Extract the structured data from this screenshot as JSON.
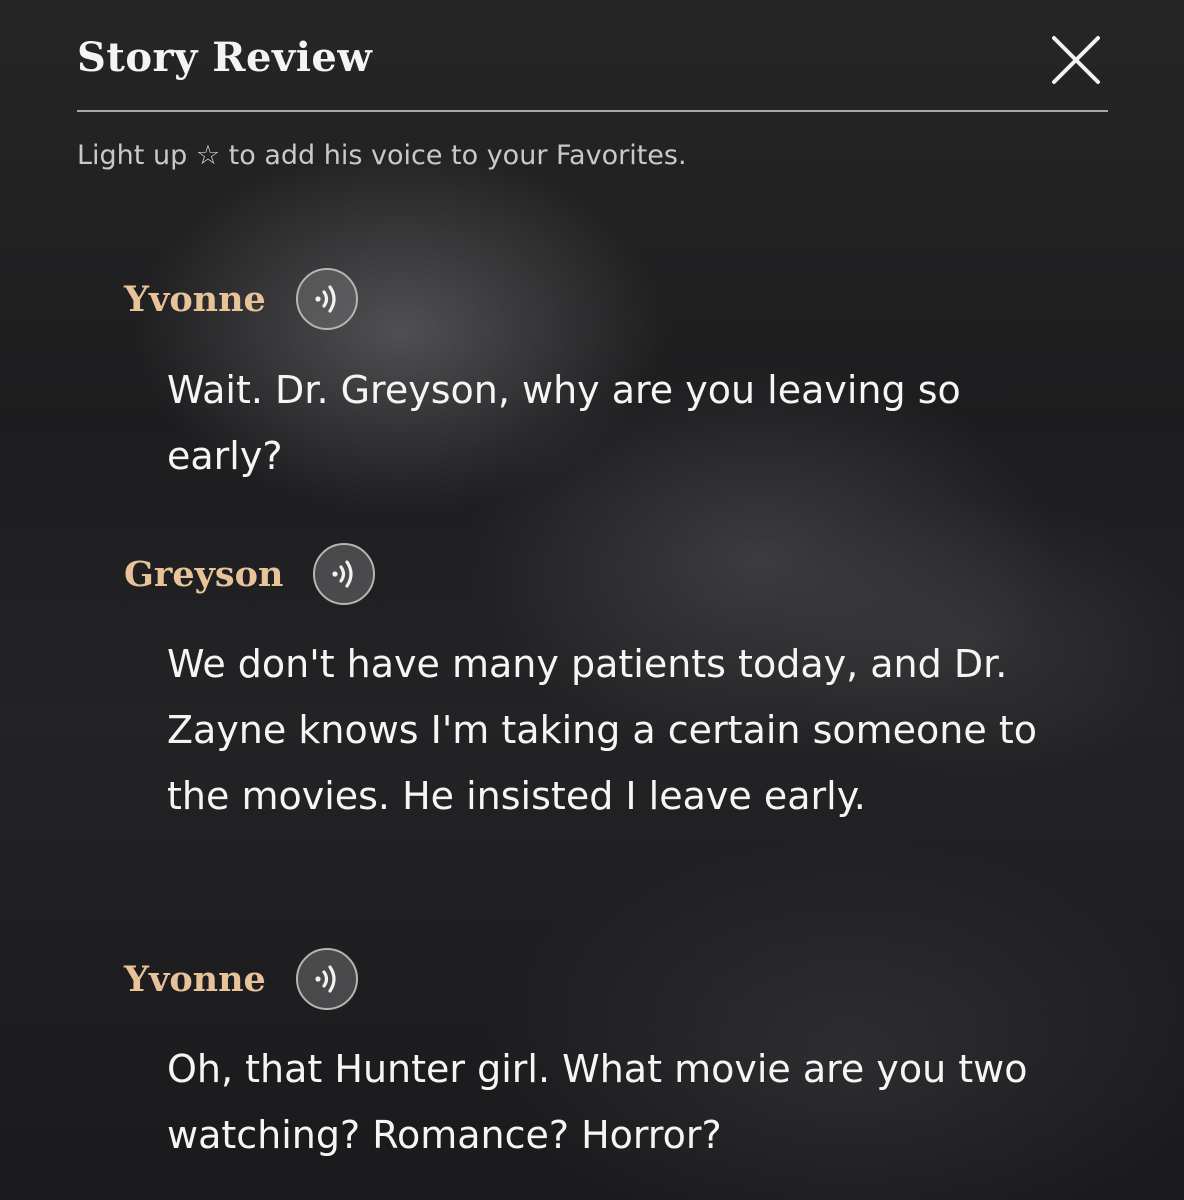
{
  "header": {
    "title": "Story Review",
    "close_icon": "close-icon"
  },
  "hint": {
    "before": "Light up",
    "star": "☆",
    "after": "to add his voice to your Favorites."
  },
  "colors": {
    "speaker_name": "#e8c39a",
    "dialogue_text": "#f5f5f5",
    "hint_text": "#c9c9c9"
  },
  "entries": [
    {
      "speaker": "Yvonne",
      "voice_icon": "voice-play-icon",
      "text": "Wait. Dr. Greyson, why are you leaving so early?"
    },
    {
      "speaker": "Greyson",
      "voice_icon": "voice-play-icon",
      "text": "We don't have many patients today, and Dr. Zayne knows I'm taking a certain someone to the movies. He insisted I leave early."
    },
    {
      "speaker": "Yvonne",
      "voice_icon": "voice-play-icon",
      "text": "Oh, that Hunter girl. What movie are you two watching? Romance? Horror?"
    }
  ]
}
